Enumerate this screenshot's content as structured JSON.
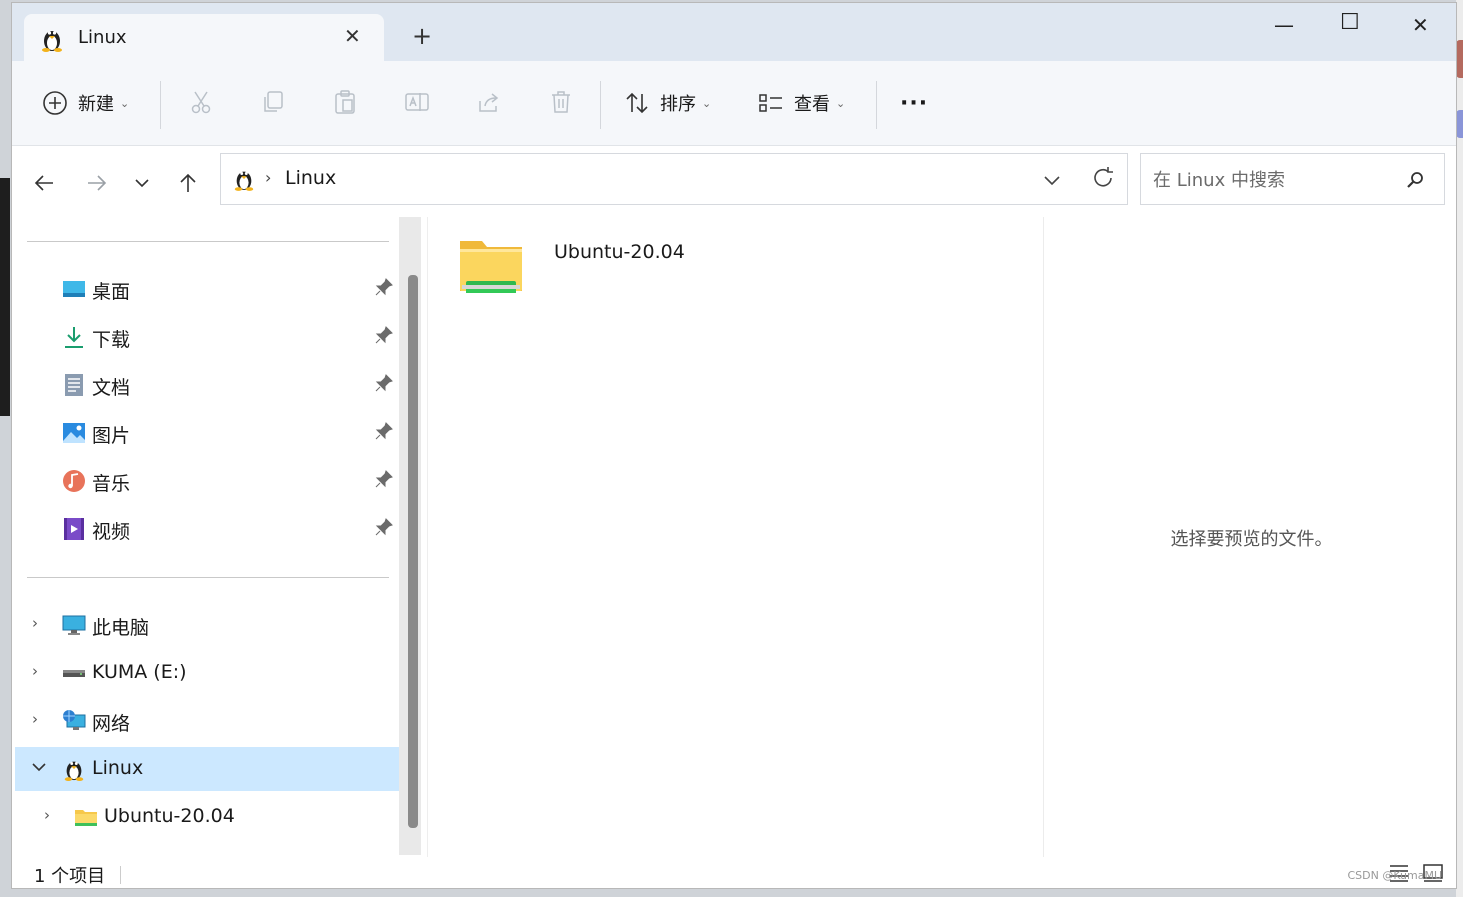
{
  "window": {
    "tab_title": "Linux",
    "new_tab": "+",
    "controls": {
      "minimize": "—",
      "maximize": "☐",
      "close": "✕"
    }
  },
  "toolbar": {
    "new_label": "新建",
    "sort_label": "排序",
    "view_label": "查看",
    "more_label": "···"
  },
  "address": {
    "crumb": "Linux",
    "separator": "›"
  },
  "search": {
    "placeholder": "在 Linux 中搜索"
  },
  "sidebar": {
    "quick_access": [
      {
        "label": "桌面",
        "icon": "desktop-icon"
      },
      {
        "label": "下载",
        "icon": "download-icon"
      },
      {
        "label": "文档",
        "icon": "documents-icon"
      },
      {
        "label": "图片",
        "icon": "pictures-icon"
      },
      {
        "label": "音乐",
        "icon": "music-icon"
      },
      {
        "label": "视频",
        "icon": "videos-icon"
      }
    ],
    "tree": [
      {
        "label": "此电脑",
        "icon": "computer-icon",
        "expanded": false
      },
      {
        "label": "KUMA (E:)",
        "icon": "drive-icon",
        "expanded": false
      },
      {
        "label": "网络",
        "icon": "network-icon",
        "expanded": false
      },
      {
        "label": "Linux",
        "icon": "linux-icon",
        "expanded": true,
        "selected": true
      },
      {
        "label": "Ubuntu-20.04",
        "icon": "folder-icon",
        "expanded": false
      }
    ]
  },
  "content": {
    "items": [
      {
        "label": "Ubuntu-20.04",
        "icon": "distro-folder-icon"
      }
    ]
  },
  "preview": {
    "message": "选择要预览的文件。"
  },
  "status": {
    "count": "1 个项目"
  },
  "watermark": "CSDN @KumaMU",
  "colors": {
    "selection": "#cce8ff",
    "titlebar": "#dfe7f1",
    "toolbar": "#f5f7fa",
    "folder": "#f6c84b"
  }
}
